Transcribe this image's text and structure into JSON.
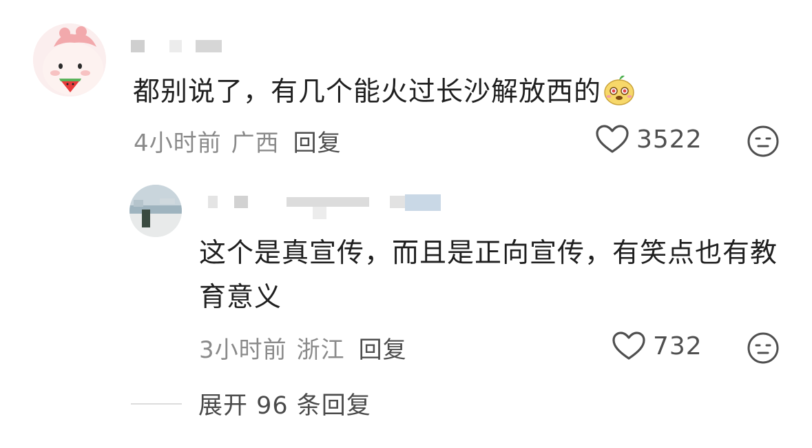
{
  "comment": {
    "text": "都别说了，有几个能火过长沙解放西的",
    "emoji": "cute-face-emoji",
    "time": "4小时前",
    "location": "广西",
    "reply_label": "回复",
    "likes": "3522"
  },
  "reply": {
    "text": "这个是真宣传，而且是正向宣传，有笑点也有教育意义",
    "time": "3小时前",
    "location": "浙江",
    "reply_label": "回复",
    "likes": "732"
  },
  "expand": {
    "label": "展开 96 条回复"
  },
  "icons": {
    "like": "heart-outline-icon",
    "dislike": "meh-face-icon"
  },
  "colors": {
    "text": "#1f1f1f",
    "meta": "#8a8a8a",
    "icon": "#4f4f4f"
  }
}
